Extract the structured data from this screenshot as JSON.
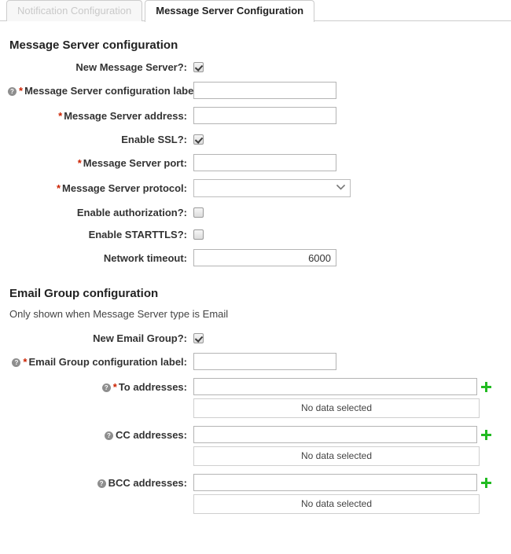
{
  "tabs": [
    {
      "label": "Notification Configuration",
      "active": false
    },
    {
      "label": "Message Server Configuration",
      "active": true
    }
  ],
  "message_server_section": {
    "title": "Message Server configuration",
    "fields": {
      "new_message_server": {
        "label": "New Message Server?:",
        "type": "checkbox",
        "checked": true,
        "help": false,
        "required": false
      },
      "config_label": {
        "label": "Message Server configuration label:",
        "type": "text",
        "value": "",
        "help": true,
        "required": true
      },
      "address": {
        "label": "Message Server address:",
        "type": "text",
        "value": "",
        "help": false,
        "required": true
      },
      "enable_ssl": {
        "label": "Enable SSL?:",
        "type": "checkbox",
        "checked": true,
        "help": false,
        "required": false
      },
      "port": {
        "label": "Message Server port:",
        "type": "text",
        "value": "",
        "help": false,
        "required": true
      },
      "protocol": {
        "label": "Message Server protocol:",
        "type": "select",
        "value": "",
        "help": false,
        "required": true
      },
      "enable_authorization": {
        "label": "Enable authorization?:",
        "type": "checkbox",
        "checked": false,
        "help": false,
        "required": false
      },
      "enable_starttls": {
        "label": "Enable STARTTLS?:",
        "type": "checkbox",
        "checked": false,
        "help": false,
        "required": false
      },
      "network_timeout": {
        "label": "Network timeout:",
        "type": "number",
        "value": "6000",
        "help": false,
        "required": false
      }
    }
  },
  "email_group_section": {
    "title": "Email Group configuration",
    "note": "Only shown when Message Server type is Email",
    "fields": {
      "new_email_group": {
        "label": "New Email Group?:",
        "type": "checkbox",
        "checked": true,
        "help": false,
        "required": false
      },
      "group_label": {
        "label": "Email Group configuration label:",
        "type": "text",
        "value": "",
        "help": true,
        "required": true
      },
      "to_addresses": {
        "label": "To addresses:",
        "type": "address",
        "value": "",
        "help": true,
        "required": true,
        "empty_text": "No data selected"
      },
      "cc_addresses": {
        "label": "CC addresses:",
        "type": "address",
        "value": "",
        "help": true,
        "required": false,
        "empty_text": "No data selected"
      },
      "bcc_addresses": {
        "label": "BCC addresses:",
        "type": "address",
        "value": "",
        "help": true,
        "required": false,
        "empty_text": "No data selected"
      }
    }
  },
  "icons": {
    "help": "?",
    "required_marker": "*",
    "chevron_down": "⌄",
    "add": "add-plus-icon"
  },
  "colors": {
    "required": "#cc2200",
    "add_icon": "#22bb22",
    "border": "#b4b4b4",
    "text": "#333333"
  }
}
